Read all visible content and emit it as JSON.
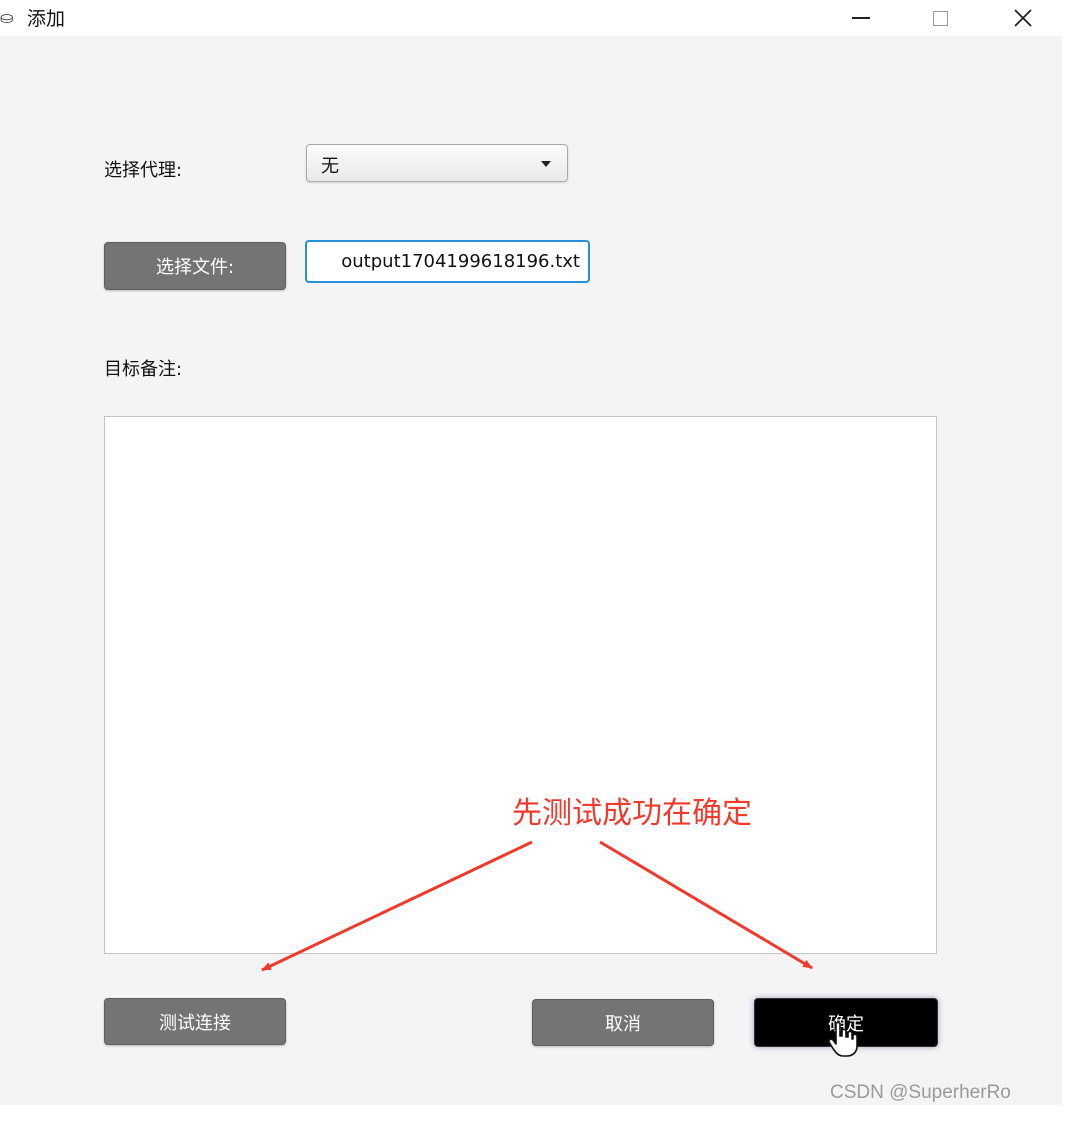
{
  "window": {
    "title": "添加",
    "app_icon": "app-icon"
  },
  "form": {
    "proxy_label": "选择代理:",
    "proxy_value": "无",
    "file_button_label": "选择文件:",
    "file_value": "output1704199618196.txt",
    "note_label": "目标备注:",
    "note_value": ""
  },
  "buttons": {
    "test_label": "测试连接",
    "cancel_label": "取消",
    "ok_label": "确定"
  },
  "annotation": {
    "text": "先测试成功在确定",
    "color": "#f03a2b"
  },
  "watermark": "CSDN @SuperherRo"
}
